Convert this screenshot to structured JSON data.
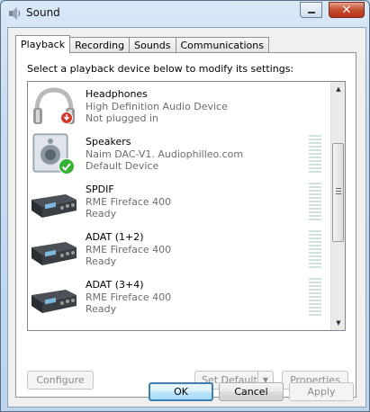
{
  "window": {
    "title": "Sound",
    "icon": "speaker-icon",
    "caption_buttons": [
      "minimize",
      "maximize",
      "close"
    ],
    "close_label": "✕"
  },
  "tabs": [
    {
      "label": "Playback",
      "active": true
    },
    {
      "label": "Recording",
      "active": false
    },
    {
      "label": "Sounds",
      "active": false
    },
    {
      "label": "Communications",
      "active": false
    }
  ],
  "instruction": "Select a playback device below to modify its settings:",
  "devices": [
    {
      "name": "Headphones",
      "line2": "High Definition Audio Device",
      "line3": "Not plugged in",
      "icon": "headphones-icon",
      "badge": "unplugged-badge-icon"
    },
    {
      "name": "Speakers",
      "line2": "Naim DAC-V1. Audiophilleo.com",
      "line3": "Default Device",
      "icon": "speakers-icon",
      "badge": "default-check-icon"
    },
    {
      "name": "SPDIF",
      "line2": "RME Fireface 400",
      "line3": "Ready",
      "icon": "audio-interface-icon"
    },
    {
      "name": "ADAT (1+2)",
      "line2": "RME Fireface 400",
      "line3": "Ready",
      "icon": "audio-interface-icon"
    },
    {
      "name": "ADAT (3+4)",
      "line2": "RME Fireface 400",
      "line3": "Ready",
      "icon": "audio-interface-icon"
    }
  ],
  "buttons": {
    "configure": "Configure",
    "set_default": "Set Default",
    "properties": "Properties",
    "ok": "OK",
    "cancel": "Cancel",
    "apply": "Apply"
  },
  "colors": {
    "meter_bar": "#cfe3d8",
    "default_check": "#34b233",
    "unplugged_badge": "#d23b2a"
  }
}
